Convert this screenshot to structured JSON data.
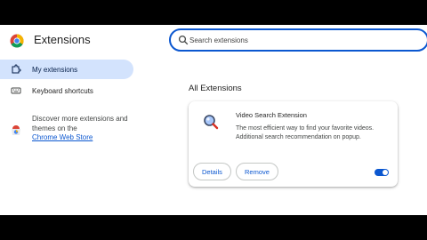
{
  "header": {
    "title": "Extensions",
    "logo_icon": "chrome-logo-icon"
  },
  "search": {
    "placeholder": "Search extensions",
    "value": "",
    "icon": "search-icon"
  },
  "sidebar": {
    "items": [
      {
        "label": "My extensions",
        "icon": "puzzle-icon",
        "active": true
      },
      {
        "label": "Keyboard shortcuts",
        "icon": "keyboard-icon",
        "active": false
      }
    ],
    "discover": {
      "text": "Discover more extensions and themes on the",
      "link": "Chrome Web Store",
      "icon": "web-store-icon"
    }
  },
  "main": {
    "section_title": "All Extensions",
    "extension": {
      "name": "Video Search Extension",
      "description": "The most efficient way to find your favorite videos. Additional search recommendation on popup.",
      "icon": "magnifier-icon",
      "details_label": "Details",
      "remove_label": "Remove",
      "enabled": true
    }
  },
  "colors": {
    "accent": "#0b57d0",
    "active_nav_bg": "#d3e3fd"
  }
}
